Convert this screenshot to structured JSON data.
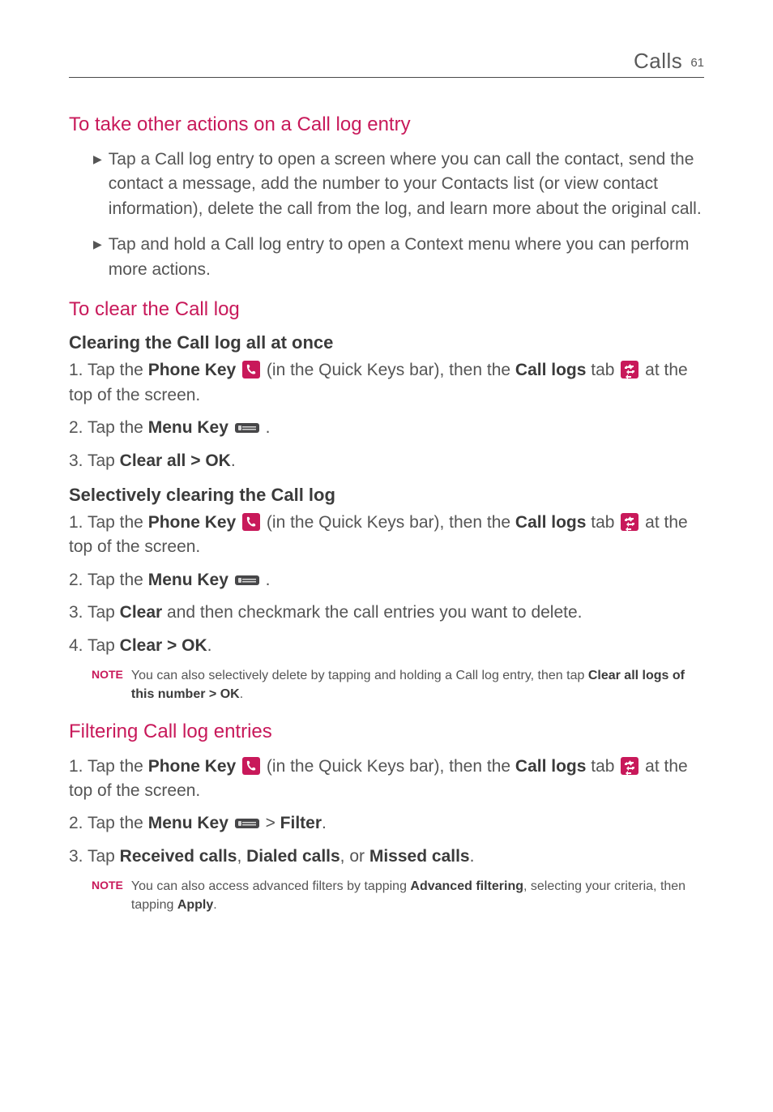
{
  "header": {
    "title": "Calls",
    "pageNumber": "61"
  },
  "s1": {
    "heading": "To take other actions on a Call log entry",
    "bullet1": "Tap a Call log entry to open a screen where you can call the contact, send the contact a message, add the number to your Contacts list (or view contact information), delete the call from the log, and learn more about the original call.",
    "bullet2": "Tap and hold a Call log entry to open a Context menu where you can perform more actions."
  },
  "s2": {
    "heading": "To clear the Call log",
    "sub1": "Clearing the Call log all at once",
    "sub1_step1_a": "1.  Tap the ",
    "sub1_step1_phonekey": "Phone Key",
    "sub1_step1_b": " (in the Quick Keys bar), then the ",
    "sub1_step1_calllogs": "Call logs",
    "sub1_step1_c": " tab ",
    "sub1_step1_d": " at the top of the screen.",
    "sub1_step2_a": "2. Tap the ",
    "sub1_step2_menukey": "Menu Key",
    "sub1_step2_b": " .",
    "sub1_step3_a": "3. Tap ",
    "sub1_step3_strong": "Clear all > OK",
    "sub1_step3_b": ".",
    "sub2": "Selectively clearing the Call log",
    "sub2_step1_a": "1.  Tap the ",
    "sub2_step1_phonekey": "Phone Key",
    "sub2_step1_b": " (in the Quick Keys bar), then the ",
    "sub2_step1_calllogs": "Call logs",
    "sub2_step1_c": " tab ",
    "sub2_step1_d": " at the top of the screen.",
    "sub2_step2_a": "2. Tap the ",
    "sub2_step2_menukey": "Menu Key",
    "sub2_step2_b": " .",
    "sub2_step3_a": "3. Tap ",
    "sub2_step3_strong": "Clear",
    "sub2_step3_b": " and then checkmark the call entries you want to delete.",
    "sub2_step4_a": "4. Tap ",
    "sub2_step4_strong": "Clear > OK",
    "sub2_step4_b": ".",
    "note1_label": "NOTE",
    "note1_a": "You can also selectively delete by tapping and holding a Call log entry, then tap ",
    "note1_strong": "Clear all logs of this number > OK",
    "note1_b": "."
  },
  "s3": {
    "heading": "Filtering Call log entries",
    "step1_a": "1.  Tap the ",
    "step1_phonekey": "Phone Key",
    "step1_b": " (in the Quick Keys bar), then the ",
    "step1_calllogs": "Call logs",
    "step1_c": " tab ",
    "step1_d": " at the top of the screen.",
    "step2_a": "2. Tap the ",
    "step2_menukey": "Menu Key",
    "step2_b": "  > ",
    "step2_strong": "Filter",
    "step2_c": ".",
    "step3_a": "3. Tap ",
    "step3_s1": "Received calls",
    "step3_b": ", ",
    "step3_s2": "Dialed calls",
    "step3_c": ", or ",
    "step3_s3": "Missed calls",
    "step3_d": ".",
    "note_label": "NOTE",
    "note_a": "You can also access advanced filters by tapping ",
    "note_strong1": "Advanced filtering",
    "note_b": ", selecting your criteria, then tapping ",
    "note_strong2": "Apply",
    "note_c": "."
  },
  "icons": {
    "phone": "phone-key-icon",
    "call_logs": "call-logs-tab-icon",
    "menu": "menu-key-icon"
  }
}
